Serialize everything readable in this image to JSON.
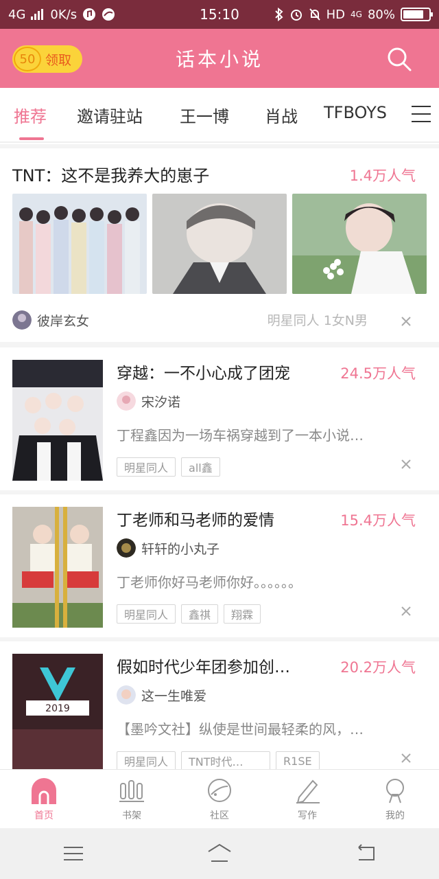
{
  "status_bar": {
    "network": "4G",
    "speed": "0K/s",
    "time": "15:10",
    "indicators": "HD",
    "net_type": "4G",
    "battery": "80%",
    "battery_level": 0.8
  },
  "header": {
    "coin_count": "50",
    "claim_label": "领取",
    "app_title": "话本小说"
  },
  "tabs": [
    {
      "label": "推荐",
      "active": true
    },
    {
      "label": "邀请驻站",
      "active": false
    },
    {
      "label": "王一博",
      "active": false
    },
    {
      "label": "肖战",
      "active": false
    },
    {
      "label": "TFBOYS",
      "active": false
    }
  ],
  "featured": {
    "title": "TNT：这不是我养大的崽子",
    "popularity": "1.4万人气",
    "author": "彼岸玄女",
    "meta": "明星同人  1女N男"
  },
  "books": [
    {
      "title": "穿越：一不小心成了团宠",
      "popularity": "24.5万人气",
      "author": "宋汐诺",
      "desc": "丁程鑫因为一场车祸穿越到了一本小说…",
      "tags": [
        "明星同人",
        "all鑫"
      ]
    },
    {
      "title": "丁老师和马老师的爱情",
      "popularity": "15.4万人气",
      "author": "轩轩的小丸子",
      "desc": "丁老师你好马老师你好。。。。。。",
      "tags": [
        "明星同人",
        "鑫祺",
        "翔霖"
      ]
    },
    {
      "title": "假如时代少年团参加创…",
      "popularity": "20.2万人气",
      "author": "这一生唯爱",
      "desc": "【墨吟文社】纵使是世间最轻柔的风，…",
      "tags": [
        "明星同人",
        "TNT时代…",
        "R1SE"
      ]
    }
  ],
  "bottom_nav": [
    {
      "label": "首页",
      "icon": "home-icon",
      "active": true
    },
    {
      "label": "书架",
      "icon": "bookshelf-icon",
      "active": false
    },
    {
      "label": "社区",
      "icon": "planet-icon",
      "active": false
    },
    {
      "label": "写作",
      "icon": "pen-icon",
      "active": false
    },
    {
      "label": "我的",
      "icon": "profile-icon",
      "active": false
    }
  ],
  "colors": {
    "brand": "#ef7592",
    "status_bar": "#7a2c3c",
    "coin": "#fbd33a"
  }
}
